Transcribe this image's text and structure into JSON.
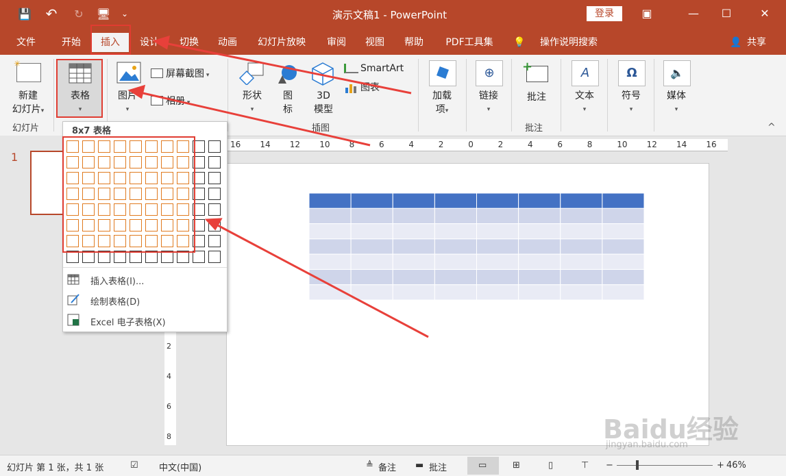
{
  "titlebar": {
    "title": "演示文稿1 - PowerPoint",
    "login_label": "登录"
  },
  "icons": {
    "save": "💾",
    "undo": "↶",
    "redo": "↻",
    "present": "🖥",
    "qat_more": "⌄",
    "ribbon_display": "▣",
    "minimize": "—",
    "maximize": "☐",
    "close": "✕",
    "tell_me": "💡",
    "share": "👤",
    "collapse": "^"
  },
  "tabs": [
    "文件",
    "开始",
    "插入",
    "设计",
    "切换",
    "动画",
    "幻灯片放映",
    "审阅",
    "视图",
    "帮助",
    "PDF工具集"
  ],
  "tell_me": "操作说明搜索",
  "share": "共享",
  "ribbon": {
    "new_slide": [
      "新建",
      "幻灯片"
    ],
    "table": "表格",
    "images": "图片",
    "screenshot": "屏幕截图",
    "album": "相册",
    "shapes": "形状",
    "icons": [
      "图",
      "标"
    ],
    "model3d": [
      "3D",
      "模型"
    ],
    "smartart": "SmartArt",
    "chart": "图表",
    "addins": [
      "加载",
      "项"
    ],
    "link": "链接",
    "comment": "批注",
    "text": "文本",
    "symbol": "符号",
    "media": "媒体",
    "group_slides": "幻灯片",
    "group_illustrations": "插图",
    "group_comments": "批注"
  },
  "table_menu": {
    "title": "8x7 表格",
    "selected_cols": 8,
    "selected_rows": 7,
    "grid_cols": 10,
    "grid_rows": 8,
    "items": [
      "插入表格(I)...",
      "绘制表格(D)",
      "Excel 电子表格(X)"
    ]
  },
  "ruler": {
    "ticks": [
      "16",
      "14",
      "12",
      "10",
      "8",
      "6",
      "4",
      "2",
      "0",
      "2",
      "4",
      "6",
      "8",
      "10",
      "12",
      "14",
      "16"
    ]
  },
  "slides_pane": {
    "slide_number": "1"
  },
  "slide_table": {
    "rows": 7,
    "cols": 8,
    "header_color": "#4472c4",
    "band_dark": "#cfd5ea",
    "band_light": "#e9ebf5"
  },
  "status": {
    "slide_info": "幻灯片 第 1 张，共 1 张",
    "language": "中文(中国)",
    "notes": "备注",
    "comments": "批注",
    "zoom": "46%"
  },
  "watermark": "Baidu经验",
  "watermark_url": "jingyan.baidu.com"
}
